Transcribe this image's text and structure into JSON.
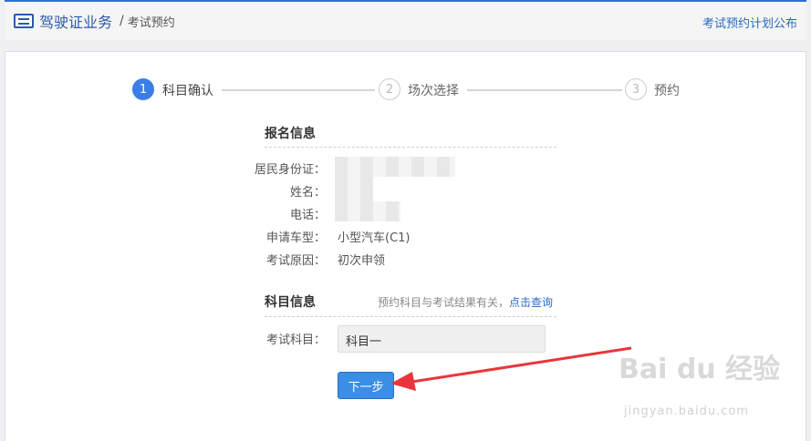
{
  "header": {
    "title": "驾驶证业务",
    "separator": "/",
    "subtitle": "考试预约",
    "right_link": "考试预约计划公布",
    "icon": "list-icon"
  },
  "steps": [
    {
      "number": "1",
      "label": "科目确认",
      "active": true
    },
    {
      "number": "2",
      "label": "场次选择",
      "active": false
    },
    {
      "number": "3",
      "label": "预约",
      "active": false
    }
  ],
  "registration": {
    "title": "报名信息",
    "rows": [
      {
        "label": "居民身份证：",
        "value": ""
      },
      {
        "label": "姓名：",
        "value": ""
      },
      {
        "label": "电话：",
        "value": ""
      },
      {
        "label": "申请车型：",
        "value": "小型汽车(C1)"
      },
      {
        "label": "考试原因：",
        "value": "初次申领"
      }
    ]
  },
  "subject": {
    "title": "科目信息",
    "hint": "预约科目与考试结果有关，",
    "hint_link": "点击查询",
    "field_label": "考试科目：",
    "field_value": "科目一"
  },
  "next_button": "下一步",
  "watermark": {
    "text": "Bai du 经验",
    "sub": "jingyan.baidu.com"
  },
  "colors": {
    "accent": "#3a7ee6",
    "link": "#2a6bc0",
    "arrow": "#e8363c"
  }
}
